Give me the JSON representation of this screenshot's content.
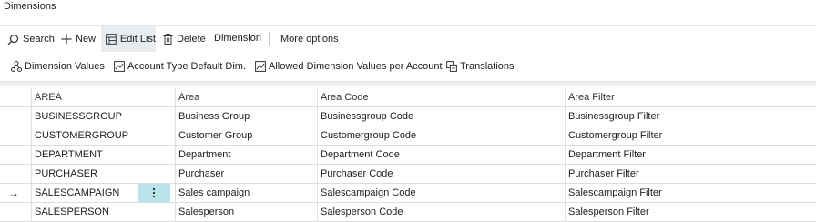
{
  "page": {
    "title": "Dimensions"
  },
  "actions": {
    "search": "Search",
    "new": "New",
    "edit_list": "Edit List",
    "delete": "Delete",
    "dimension": "Dimension",
    "more": "More options"
  },
  "subactions": {
    "dimension_values": "Dimension Values",
    "account_type": "Account Type Default Dim.",
    "allowed_values": "Allowed Dimension Values per Account",
    "translations": "Translations"
  },
  "table": {
    "rows": [
      {
        "code": "AREA",
        "name": "Area",
        "code_caption": "Area Code",
        "filter_caption": "Area Filter"
      },
      {
        "code": "BUSINESSGROUP",
        "name": "Business Group",
        "code_caption": "Businessgroup Code",
        "filter_caption": "Businessgroup Filter"
      },
      {
        "code": "CUSTOMERGROUP",
        "name": "Customer Group",
        "code_caption": "Customergroup Code",
        "filter_caption": "Customergroup Filter"
      },
      {
        "code": "DEPARTMENT",
        "name": "Department",
        "code_caption": "Department Code",
        "filter_caption": "Department Filter"
      },
      {
        "code": "PURCHASER",
        "name": "Purchaser",
        "code_caption": "Purchaser Code",
        "filter_caption": "Purchaser Filter"
      },
      {
        "code": "SALESCAMPAIGN",
        "name": "Sales campaign",
        "code_caption": "Salescampaign Code",
        "filter_caption": "Salescampaign Filter"
      },
      {
        "code": "SALESPERSON",
        "name": "Salesperson",
        "code_caption": "Salesperson Code",
        "filter_caption": "Salesperson Filter"
      }
    ],
    "selected_row": 5
  },
  "colors": {
    "accent": "#1a6d70",
    "selection": "#b8e4ea"
  },
  "icons": {
    "search": "search-icon",
    "new": "plus-icon",
    "edit_list": "edit-list-icon",
    "delete": "trash-icon",
    "dimension_values": "dimension-values-icon",
    "account_type": "report-icon",
    "allowed_values": "report-icon",
    "translations": "translations-icon",
    "row_menu": "vertical-dots-icon",
    "current_row": "arrow-right-icon"
  }
}
